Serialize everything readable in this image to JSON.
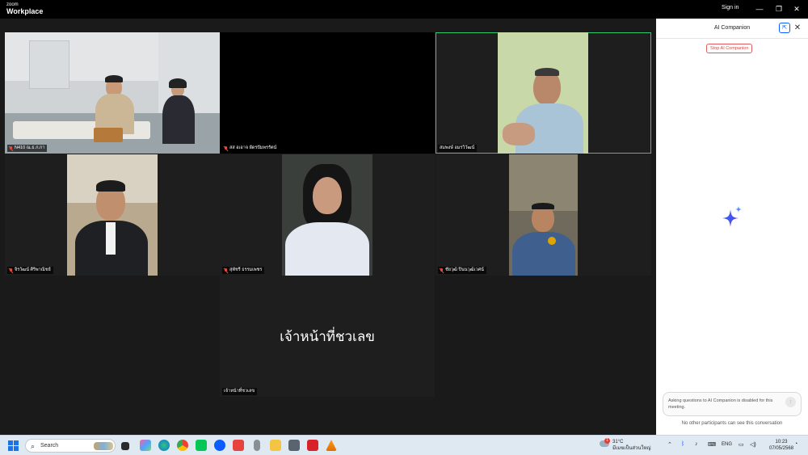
{
  "app": {
    "logo_small": "zoom",
    "logo_big": "Workplace"
  },
  "titlebar": {
    "signin": "Sign in",
    "minimize": "—",
    "restore": "❐",
    "close": "✕"
  },
  "participants": [
    {
      "name": "N410 ณ.ธ.ก.กา",
      "muted": true,
      "active": false
    },
    {
      "name": "สส อเอาจ ผัดรปัมพรรัตน์",
      "muted": true,
      "active": false
    },
    {
      "name": "สมพงษ์ อมรวิวัฒน์",
      "muted": false,
      "active": true
    },
    {
      "name": "จิรวัฒน์ ศิริพาณิชย์",
      "muted": true,
      "active": false
    },
    {
      "name": "สุพัชรี ธรรมเพชร",
      "muted": true,
      "active": false
    },
    {
      "name": "ชัยวุฒิ ปินนวุฒิเวศน์",
      "muted": true,
      "active": false
    },
    {
      "name": "เจ้าหน้าที่ชวเลข",
      "muted": false,
      "active": false,
      "display_name": "เจ้าหน้าที่ชวเลข"
    }
  ],
  "ai_panel": {
    "title": "AI Companion",
    "popout_icon": "popout-icon",
    "close_icon": "close-icon",
    "stop_button": "Stop AI Companion",
    "input_placeholder": "Asking questions to AI Companion is disabled for this meeting.",
    "footer": "No other participants can see this conversation"
  },
  "taskbar": {
    "search_label": "Search",
    "weather_temp": "31°C",
    "weather_desc": "มีเมฆเป็นส่วนใหญ่",
    "weather_badge": "1",
    "language": "ENG",
    "time": "10:23",
    "date": "07/05/2568"
  },
  "colors": {
    "active_speaker": "#2ecc71",
    "stop_button": "#d64545",
    "accent": "#0b5cff"
  }
}
